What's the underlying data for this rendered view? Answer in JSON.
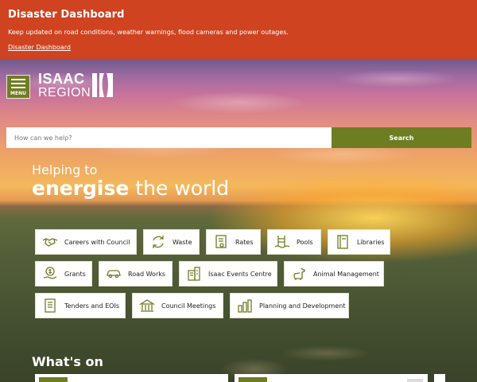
{
  "alert": {
    "title": "Disaster Dashboard",
    "text": "Keep updated on road conditions, weather warnings, flood cameras and power outages.",
    "link": "Disaster Dashboard"
  },
  "header": {
    "menu_label": "MENU",
    "logo_line1": "ISAAC",
    "logo_line2": "REGION"
  },
  "search": {
    "placeholder": "How can we help?",
    "button": "Search"
  },
  "hero": {
    "tagline_small": "Helping to",
    "tagline_bold": "energise",
    "tagline_rest": "the world"
  },
  "quick_links": [
    {
      "label": "Careers with Council",
      "icon": "handshake-icon"
    },
    {
      "label": "Waste",
      "icon": "recycle-icon"
    },
    {
      "label": "Rates",
      "icon": "certificate-icon"
    },
    {
      "label": "Pools",
      "icon": "pool-ladder-icon"
    },
    {
      "label": "Libraries",
      "icon": "book-icon"
    },
    {
      "label": "Grants",
      "icon": "money-hand-icon"
    },
    {
      "label": "Road Works",
      "icon": "car-icon"
    },
    {
      "label": "Isaac Events Centre",
      "icon": "building-icon"
    },
    {
      "label": "Animal Management",
      "icon": "dog-icon"
    },
    {
      "label": "Tenders and EOIs",
      "icon": "document-icon"
    },
    {
      "label": "Council Meetings",
      "icon": "government-building-icon"
    },
    {
      "label": "Planning and Development",
      "icon": "chart-building-icon"
    }
  ],
  "whats_on": {
    "heading": "What's on"
  },
  "colors": {
    "alert": "#cf4320",
    "accent": "#6f7d22",
    "icon": "#6f7d22"
  }
}
